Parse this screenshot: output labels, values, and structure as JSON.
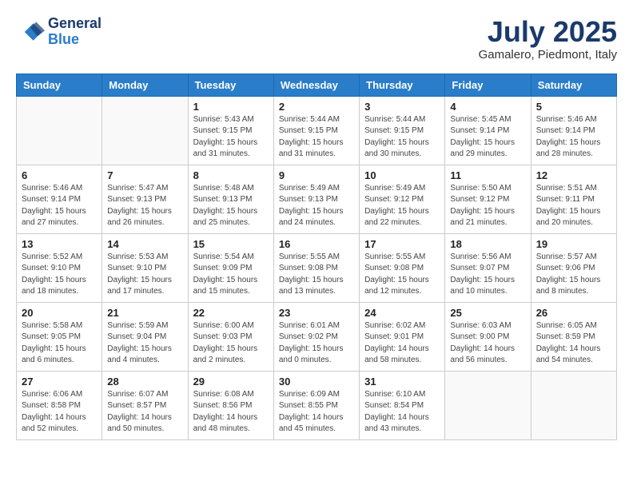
{
  "header": {
    "logo_line1": "General",
    "logo_line2": "Blue",
    "month": "July 2025",
    "location": "Gamalero, Piedmont, Italy"
  },
  "weekdays": [
    "Sunday",
    "Monday",
    "Tuesday",
    "Wednesday",
    "Thursday",
    "Friday",
    "Saturday"
  ],
  "weeks": [
    [
      {
        "day": "",
        "info": ""
      },
      {
        "day": "",
        "info": ""
      },
      {
        "day": "1",
        "info": "Sunrise: 5:43 AM\nSunset: 9:15 PM\nDaylight: 15 hours\nand 31 minutes."
      },
      {
        "day": "2",
        "info": "Sunrise: 5:44 AM\nSunset: 9:15 PM\nDaylight: 15 hours\nand 31 minutes."
      },
      {
        "day": "3",
        "info": "Sunrise: 5:44 AM\nSunset: 9:15 PM\nDaylight: 15 hours\nand 30 minutes."
      },
      {
        "day": "4",
        "info": "Sunrise: 5:45 AM\nSunset: 9:14 PM\nDaylight: 15 hours\nand 29 minutes."
      },
      {
        "day": "5",
        "info": "Sunrise: 5:46 AM\nSunset: 9:14 PM\nDaylight: 15 hours\nand 28 minutes."
      }
    ],
    [
      {
        "day": "6",
        "info": "Sunrise: 5:46 AM\nSunset: 9:14 PM\nDaylight: 15 hours\nand 27 minutes."
      },
      {
        "day": "7",
        "info": "Sunrise: 5:47 AM\nSunset: 9:13 PM\nDaylight: 15 hours\nand 26 minutes."
      },
      {
        "day": "8",
        "info": "Sunrise: 5:48 AM\nSunset: 9:13 PM\nDaylight: 15 hours\nand 25 minutes."
      },
      {
        "day": "9",
        "info": "Sunrise: 5:49 AM\nSunset: 9:13 PM\nDaylight: 15 hours\nand 24 minutes."
      },
      {
        "day": "10",
        "info": "Sunrise: 5:49 AM\nSunset: 9:12 PM\nDaylight: 15 hours\nand 22 minutes."
      },
      {
        "day": "11",
        "info": "Sunrise: 5:50 AM\nSunset: 9:12 PM\nDaylight: 15 hours\nand 21 minutes."
      },
      {
        "day": "12",
        "info": "Sunrise: 5:51 AM\nSunset: 9:11 PM\nDaylight: 15 hours\nand 20 minutes."
      }
    ],
    [
      {
        "day": "13",
        "info": "Sunrise: 5:52 AM\nSunset: 9:10 PM\nDaylight: 15 hours\nand 18 minutes."
      },
      {
        "day": "14",
        "info": "Sunrise: 5:53 AM\nSunset: 9:10 PM\nDaylight: 15 hours\nand 17 minutes."
      },
      {
        "day": "15",
        "info": "Sunrise: 5:54 AM\nSunset: 9:09 PM\nDaylight: 15 hours\nand 15 minutes."
      },
      {
        "day": "16",
        "info": "Sunrise: 5:55 AM\nSunset: 9:08 PM\nDaylight: 15 hours\nand 13 minutes."
      },
      {
        "day": "17",
        "info": "Sunrise: 5:55 AM\nSunset: 9:08 PM\nDaylight: 15 hours\nand 12 minutes."
      },
      {
        "day": "18",
        "info": "Sunrise: 5:56 AM\nSunset: 9:07 PM\nDaylight: 15 hours\nand 10 minutes."
      },
      {
        "day": "19",
        "info": "Sunrise: 5:57 AM\nSunset: 9:06 PM\nDaylight: 15 hours\nand 8 minutes."
      }
    ],
    [
      {
        "day": "20",
        "info": "Sunrise: 5:58 AM\nSunset: 9:05 PM\nDaylight: 15 hours\nand 6 minutes."
      },
      {
        "day": "21",
        "info": "Sunrise: 5:59 AM\nSunset: 9:04 PM\nDaylight: 15 hours\nand 4 minutes."
      },
      {
        "day": "22",
        "info": "Sunrise: 6:00 AM\nSunset: 9:03 PM\nDaylight: 15 hours\nand 2 minutes."
      },
      {
        "day": "23",
        "info": "Sunrise: 6:01 AM\nSunset: 9:02 PM\nDaylight: 15 hours\nand 0 minutes."
      },
      {
        "day": "24",
        "info": "Sunrise: 6:02 AM\nSunset: 9:01 PM\nDaylight: 14 hours\nand 58 minutes."
      },
      {
        "day": "25",
        "info": "Sunrise: 6:03 AM\nSunset: 9:00 PM\nDaylight: 14 hours\nand 56 minutes."
      },
      {
        "day": "26",
        "info": "Sunrise: 6:05 AM\nSunset: 8:59 PM\nDaylight: 14 hours\nand 54 minutes."
      }
    ],
    [
      {
        "day": "27",
        "info": "Sunrise: 6:06 AM\nSunset: 8:58 PM\nDaylight: 14 hours\nand 52 minutes."
      },
      {
        "day": "28",
        "info": "Sunrise: 6:07 AM\nSunset: 8:57 PM\nDaylight: 14 hours\nand 50 minutes."
      },
      {
        "day": "29",
        "info": "Sunrise: 6:08 AM\nSunset: 8:56 PM\nDaylight: 14 hours\nand 48 minutes."
      },
      {
        "day": "30",
        "info": "Sunrise: 6:09 AM\nSunset: 8:55 PM\nDaylight: 14 hours\nand 45 minutes."
      },
      {
        "day": "31",
        "info": "Sunrise: 6:10 AM\nSunset: 8:54 PM\nDaylight: 14 hours\nand 43 minutes."
      },
      {
        "day": "",
        "info": ""
      },
      {
        "day": "",
        "info": ""
      }
    ]
  ]
}
